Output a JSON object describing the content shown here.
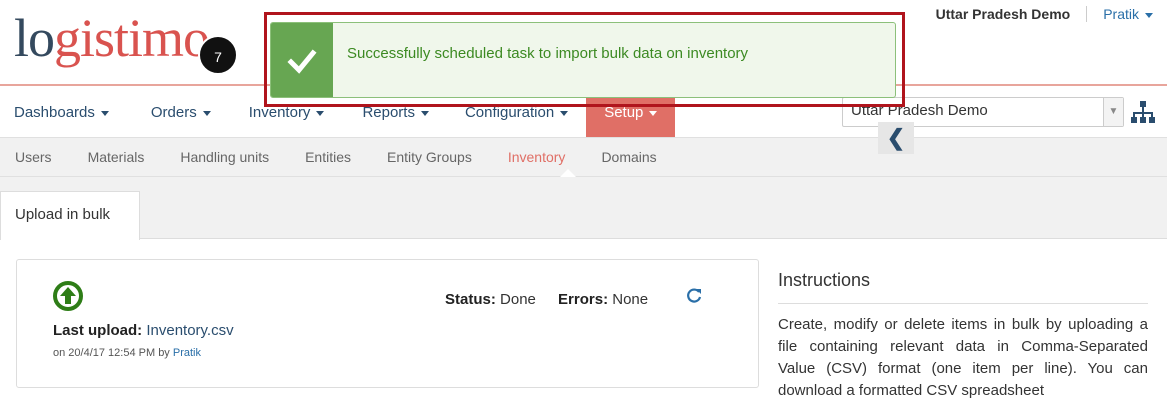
{
  "header": {
    "logo_text_a": "lo",
    "logo_text_b": "gistimo",
    "domain_name": "Uttar Pradesh Demo",
    "user_name": "Pratik"
  },
  "main_nav": {
    "items": [
      {
        "label": "Dashboards"
      },
      {
        "label": "Orders"
      },
      {
        "label": "Inventory"
      },
      {
        "label": "Reports"
      },
      {
        "label": "Configuration"
      },
      {
        "label": "Setup"
      }
    ],
    "active": "Setup"
  },
  "domain_select": {
    "value": "Uttar Pradesh Demo"
  },
  "sub_nav": {
    "items": [
      {
        "label": "Users"
      },
      {
        "label": "Materials"
      },
      {
        "label": "Handling units"
      },
      {
        "label": "Entities"
      },
      {
        "label": "Entity Groups"
      },
      {
        "label": "Inventory"
      },
      {
        "label": "Domains"
      }
    ],
    "active": "Inventory"
  },
  "tab": {
    "label": "Upload in bulk"
  },
  "upload_card": {
    "last_upload_label": "Last upload:",
    "file_name": "Inventory.csv",
    "meta_prefix": "on 20/4/17 12:54 PM by",
    "uploader": "Pratik",
    "status_label": "Status:",
    "status_value": "Done",
    "errors_label": "Errors:",
    "errors_value": "None"
  },
  "instructions": {
    "title": "Instructions",
    "text": "Create, modify or delete items in bulk by uploading a file containing relevant data in Comma-Separated Value (CSV) format (one item per line). You can download a formatted CSV spreadsheet"
  },
  "toast": {
    "message": "Successfully scheduled task to import bulk data on inventory"
  },
  "step_badge": "7",
  "colors": {
    "accent": "#e06f66",
    "nav_text": "#2a4d6e",
    "success_green": "#67a652",
    "highlight_red": "#b0141c"
  }
}
